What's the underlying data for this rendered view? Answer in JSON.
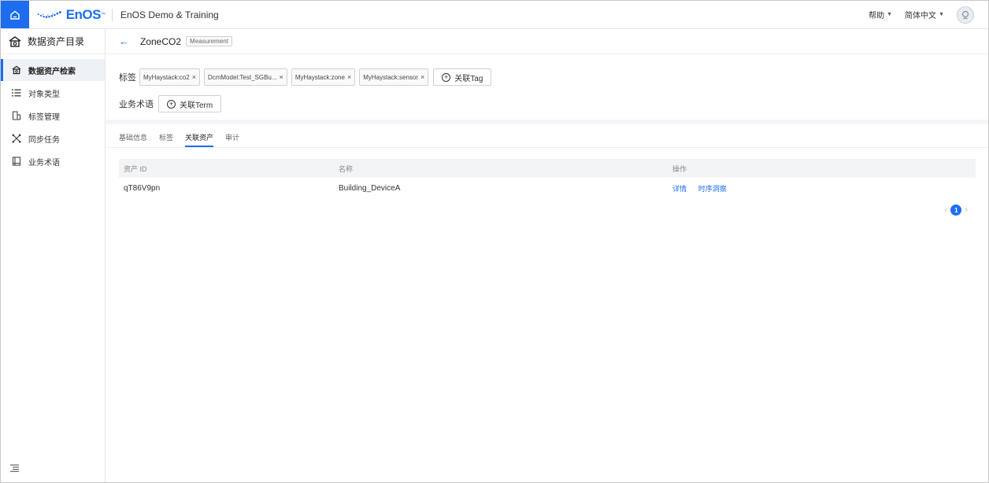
{
  "header": {
    "logo_text": "EnOS",
    "app_title": "EnOS Demo & Training",
    "help_label": "帮助",
    "language_label": "简体中文"
  },
  "sidebar": {
    "title": "数据资产目录",
    "items": [
      {
        "label": "数据资产检索",
        "icon": "asset-search-icon"
      },
      {
        "label": "对象类型",
        "icon": "list-icon"
      },
      {
        "label": "标签管理",
        "icon": "tag-manage-icon"
      },
      {
        "label": "同步任务",
        "icon": "sync-icon"
      },
      {
        "label": "业务术语",
        "icon": "book-icon"
      }
    ]
  },
  "breadcrumb": {
    "title": "ZoneCO2",
    "badge": "Measurement"
  },
  "tags": {
    "label": "标签",
    "items": [
      "MyHaystack:co2",
      "DcmModel:Test_SGBu...",
      "MyHaystack:zone",
      "MyHaystack:sensor"
    ],
    "add_label": "关联Tag"
  },
  "terms": {
    "label": "业务术语",
    "add_label": "关联Term"
  },
  "tabs": [
    "基础信息",
    "标签",
    "关联资产",
    "审计"
  ],
  "table": {
    "columns": [
      "资产 ID",
      "名称",
      "操作"
    ],
    "rows": [
      {
        "id": "qT86V9pn",
        "name": "Building_DeviceA",
        "actions": [
          "详情",
          "时序洞察"
        ]
      }
    ]
  },
  "pagination": {
    "current_page": "1"
  },
  "colors": {
    "accent": "#1c6df0"
  }
}
